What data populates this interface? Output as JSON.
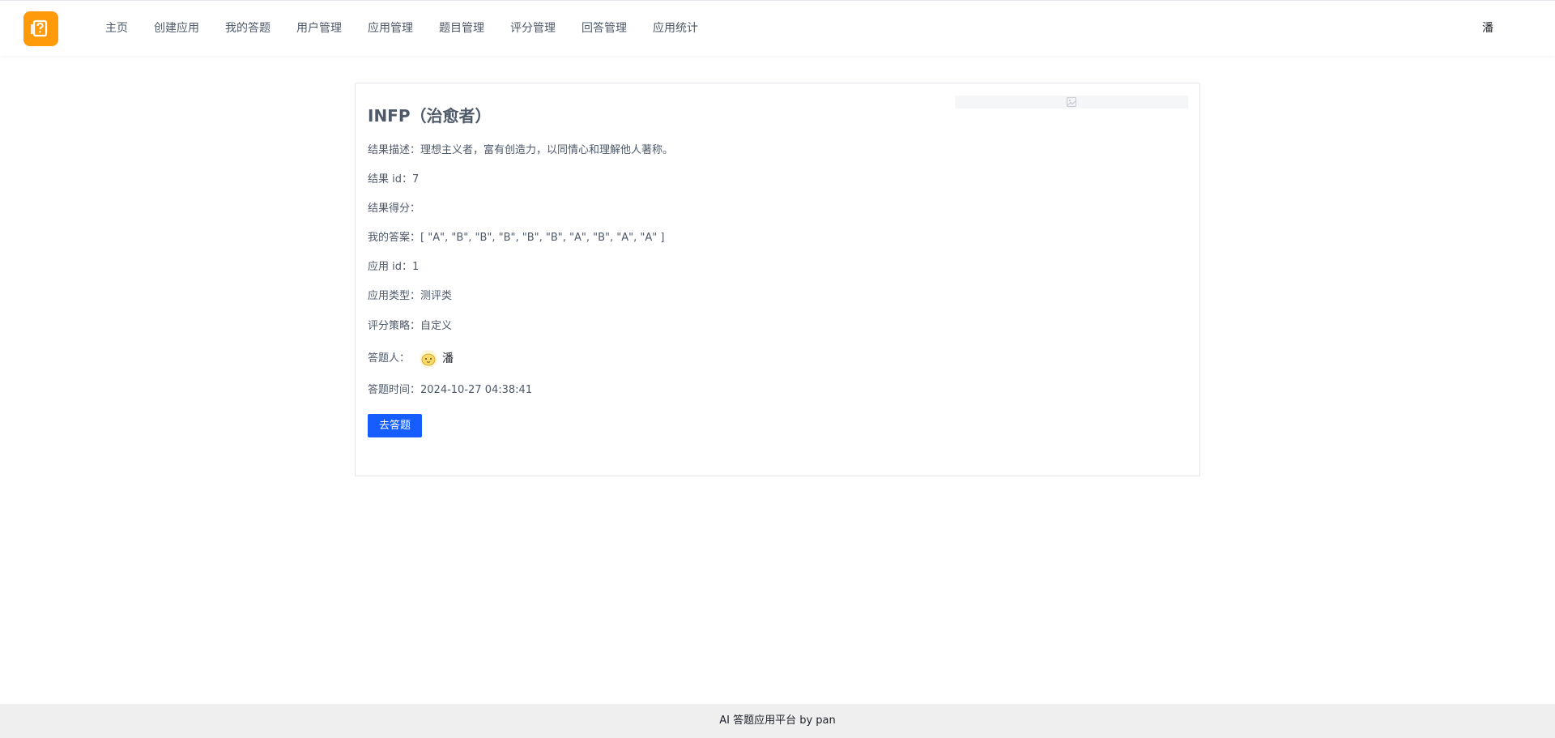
{
  "header": {
    "logo_icon": "question-box-icon",
    "nav": [
      {
        "label": "主页"
      },
      {
        "label": "创建应用"
      },
      {
        "label": "我的答题"
      },
      {
        "label": "用户管理"
      },
      {
        "label": "应用管理"
      },
      {
        "label": "题目管理"
      },
      {
        "label": "评分管理"
      },
      {
        "label": "回答管理"
      },
      {
        "label": "应用统计"
      }
    ],
    "user_name": "潘"
  },
  "result": {
    "title": "INFP（治愈者）",
    "description_label": "结果描述：",
    "description": "理想主义者，富有创造力，以同情心和理解他人著称。",
    "id_label": "结果 id：",
    "id": "7",
    "score_label": "结果得分：",
    "score": "",
    "answers_label": "我的答案：",
    "answers": "[ \"A\", \"B\", \"B\", \"B\", \"B\", \"B\", \"A\", \"B\", \"A\", \"A\" ]",
    "app_id_label": "应用 id：",
    "app_id": "1",
    "app_type_label": "应用类型：",
    "app_type": "测评类",
    "strategy_label": "评分策略：",
    "strategy": "自定义",
    "answerer_label": "答题人：",
    "answerer_name": "潘",
    "time_label": "答题时间：",
    "time": "2024-10-27 04:38:41",
    "go_button": "去答题",
    "image_icon": "broken-image-icon"
  },
  "footer": {
    "text": "AI 答题应用平台 by pan"
  },
  "colors": {
    "accent": "#165dff",
    "logo": "#ff9a0b",
    "footer_bg": "#efefef"
  }
}
